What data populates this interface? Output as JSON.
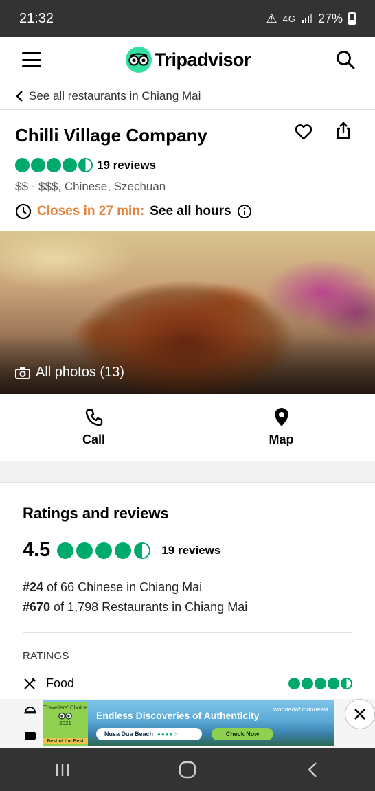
{
  "status_bar": {
    "time": "21:32",
    "network": "4G",
    "battery": "27%"
  },
  "header": {
    "brand": "Tripadvisor",
    "brand_color": "#34e0a1",
    "icons": [
      "hamburger-menu-icon",
      "owl-logo-icon",
      "search-icon"
    ]
  },
  "breadcrumb": {
    "label": "See all restaurants in Chiang Mai"
  },
  "restaurant": {
    "name": "Chilli Village Company",
    "rating": 4.5,
    "reviews_label": "19 reviews",
    "price_cuisine": "$$ - $$$, Chinese, Szechuan",
    "closes_label": "Closes in 27 min:",
    "see_hours_label": "See all hours",
    "closes_color": "#e5833a",
    "bubble_color": "#00aa6c"
  },
  "photo": {
    "label": "All photos (13)"
  },
  "actions": {
    "call_label": "Call",
    "map_label": "Map"
  },
  "ratings": {
    "title": "Ratings and reviews",
    "score": "4.5",
    "score_value": 4.5,
    "reviews_label": "19 reviews",
    "rank1_num": "#24",
    "rank1_text": " of 66 Chinese in Chiang Mai",
    "rank2_num": "#670",
    "rank2_text": " of 1,798 Restaurants in Chiang Mai",
    "section_label": "RATINGS",
    "food_label": "Food",
    "food_rating": 4.5
  },
  "ad": {
    "badge_title": "Travellers' Choice",
    "badge_year": "2021",
    "badge_best": "Best of the Best",
    "headline": "Endless Discoveries of Authenticity",
    "pill_text": "Nusa Dua Beach",
    "cta": "Check Now",
    "brand": "wonderful indonesia"
  }
}
